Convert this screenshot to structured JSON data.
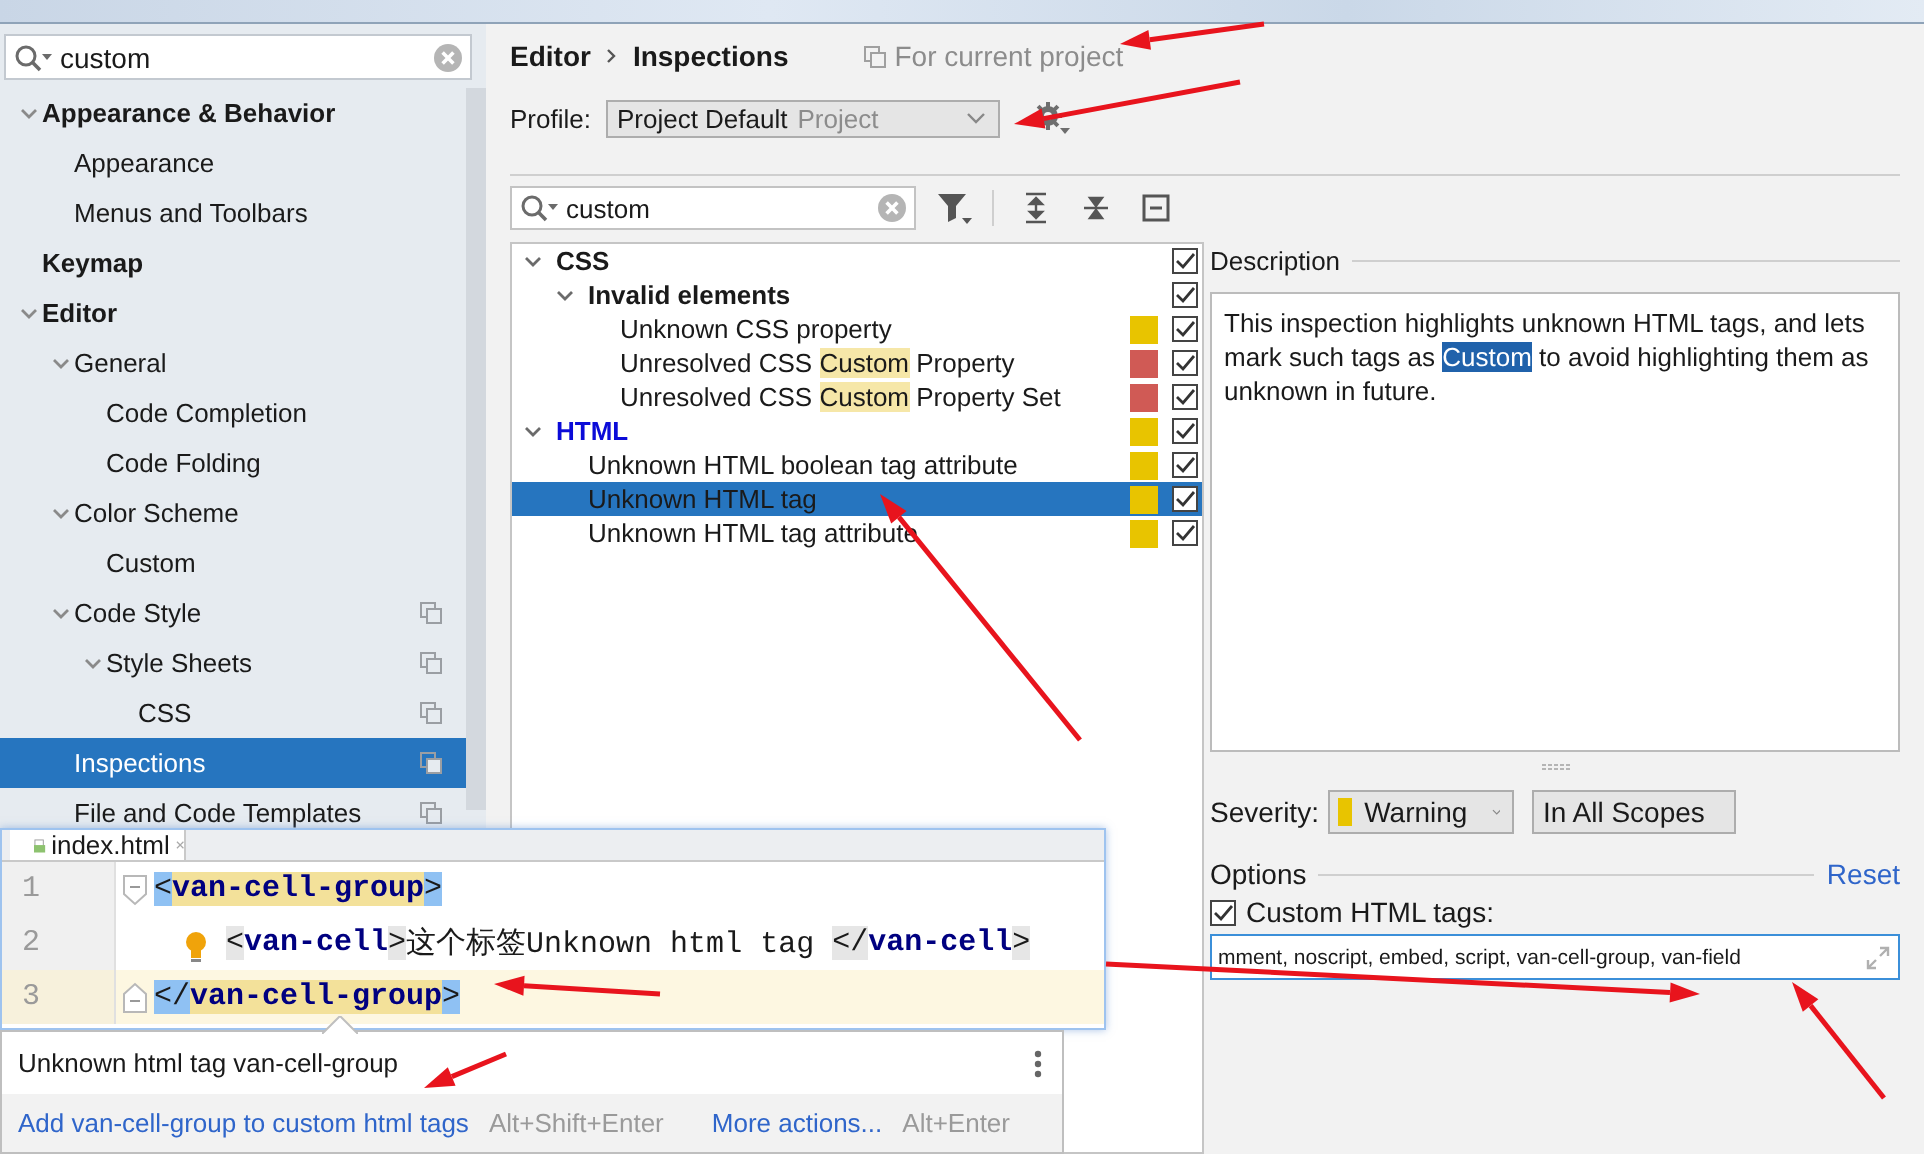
{
  "sidebar": {
    "search": {
      "value": "custom"
    },
    "items": [
      {
        "label": "Appearance & Behavior",
        "expanded": true,
        "selected": false,
        "children": [
          {
            "label": "Appearance",
            "selected": false
          },
          {
            "label": "Menus and Toolbars",
            "selected": false
          }
        ]
      },
      {
        "label": "Keymap",
        "selected": false
      },
      {
        "label": "Editor",
        "expanded": true,
        "selected": false,
        "children": [
          {
            "label": "General",
            "expanded": true,
            "selected": false,
            "children": [
              {
                "label": "Code Completion",
                "selected": false
              },
              {
                "label": "Code Folding",
                "selected": false
              }
            ]
          },
          {
            "label": "Color Scheme",
            "expanded": true,
            "selected": false,
            "children": [
              {
                "label": "Custom",
                "selected": false
              }
            ]
          },
          {
            "label": "Code Style",
            "expanded": true,
            "selected": false,
            "project": true,
            "children": [
              {
                "label": "Style Sheets",
                "expanded": true,
                "selected": false,
                "project": true,
                "children": [
                  {
                    "label": "CSS",
                    "selected": false,
                    "project": true
                  }
                ]
              }
            ]
          },
          {
            "label": "Inspections",
            "selected": true,
            "project": true
          },
          {
            "label": "File and Code Templates",
            "selected": false,
            "project": true
          }
        ]
      }
    ]
  },
  "header": {
    "breadcrumb": [
      "Editor",
      "Inspections"
    ],
    "scope_note": "For current project",
    "profile": {
      "label": "Profile:",
      "value": "Project Default",
      "note": "Project"
    }
  },
  "inspections": {
    "search": {
      "value": "custom"
    },
    "tree": [
      {
        "parts": [
          {
            "text": "CSS",
            "match": false
          }
        ],
        "expanded": true,
        "checked": true,
        "selected": false,
        "modified": false,
        "children": [
          {
            "parts": [
              {
                "text": "Invalid elements",
                "match": false
              }
            ],
            "expanded": true,
            "checked": true,
            "selected": false,
            "modified": false,
            "children": [
              {
                "parts": [
                  {
                    "text": "Unknown CSS property",
                    "match": false
                  }
                ],
                "color": "#e8c400",
                "checked": true,
                "selected": false,
                "modified": false
              },
              {
                "parts": [
                  {
                    "text": "Unresolved CSS ",
                    "match": false
                  },
                  {
                    "text": "Custom",
                    "match": true
                  },
                  {
                    "text": " Property",
                    "match": false
                  }
                ],
                "color": "#d05a55",
                "checked": true,
                "selected": false,
                "modified": false
              },
              {
                "parts": [
                  {
                    "text": "Unresolved CSS ",
                    "match": false
                  },
                  {
                    "text": "Custom",
                    "match": true
                  },
                  {
                    "text": " Property Set",
                    "match": false
                  }
                ],
                "color": "#d05a55",
                "checked": true,
                "selected": false,
                "modified": false
              }
            ]
          }
        ]
      },
      {
        "parts": [
          {
            "text": "HTML",
            "match": false
          }
        ],
        "expanded": true,
        "color": "#e8c400",
        "checked": true,
        "selected": false,
        "modified": true,
        "children": [
          {
            "parts": [
              {
                "text": "Unknown HTML boolean tag attribute",
                "match": false
              }
            ],
            "color": "#e8c400",
            "checked": true,
            "selected": false,
            "modified": false
          },
          {
            "parts": [
              {
                "text": "Unknown HTML tag",
                "match": false
              }
            ],
            "color": "#e8c400",
            "checked": true,
            "selected": true,
            "modified": false
          },
          {
            "parts": [
              {
                "text": "Unknown HTML tag attribute",
                "match": false
              }
            ],
            "color": "#e8c400",
            "checked": true,
            "selected": false,
            "modified": false
          }
        ]
      }
    ],
    "description": {
      "title": "Description",
      "parts": [
        {
          "text": "This inspection highlights unknown HTML tags, and lets mark such tags as ",
          "highlighted": false
        },
        {
          "text": "Custom",
          "highlighted": true
        },
        {
          "text": " to avoid highlighting them as unknown in future.",
          "highlighted": false
        }
      ]
    },
    "severity": {
      "label": "Severity:",
      "value": "Warning",
      "color": "#e8c400",
      "scope": "In All Scopes"
    },
    "options": {
      "title": "Options",
      "reset": "Reset",
      "checkbox": {
        "label": "Custom HTML tags:",
        "checked": true
      },
      "tags_value": "mment, noscript, embed, script, van-cell-group, van-field"
    }
  },
  "editor": {
    "tab": "index.html",
    "lines": [
      {
        "number": "1",
        "current": false,
        "fold_start": true,
        "tokens": [
          {
            "kind": "bracket",
            "text": "<",
            "matched": true
          },
          {
            "kind": "tag",
            "text": "van-cell-group",
            "matched": true
          },
          {
            "kind": "bracket",
            "text": ">",
            "matched": true
          }
        ],
        "children": [
          {
            "number": "2",
            "current": false,
            "bulb": true,
            "tokens": [
              {
                "kind": "bracket",
                "text": "<",
                "matched": false
              },
              {
                "kind": "tag",
                "text": "van-cell",
                "matched": false
              },
              {
                "kind": "bracket",
                "text": ">",
                "matched": false
              },
              {
                "kind": "text",
                "text": "这个标签Unknown html tag "
              },
              {
                "kind": "bracket",
                "text": "</",
                "matched": false
              },
              {
                "kind": "tag",
                "text": "van-cell",
                "matched": false
              },
              {
                "kind": "bracket",
                "text": ">",
                "matched": false
              }
            ]
          }
        ]
      },
      {
        "number": "3",
        "current": true,
        "fold_end": true,
        "tokens": [
          {
            "kind": "bracket",
            "text": "</",
            "matched": true
          },
          {
            "kind": "tag",
            "text": "van-cell-group",
            "matched": true
          },
          {
            "kind": "bracket",
            "text": ">",
            "matched": true
          }
        ]
      }
    ]
  },
  "hint": {
    "message": "Unknown html tag van-cell-group",
    "action": "Add van-cell-group to custom html tags",
    "action_shortcut": "Alt+Shift+Enter",
    "more": "More actions...",
    "more_shortcut": "Alt+Enter"
  }
}
